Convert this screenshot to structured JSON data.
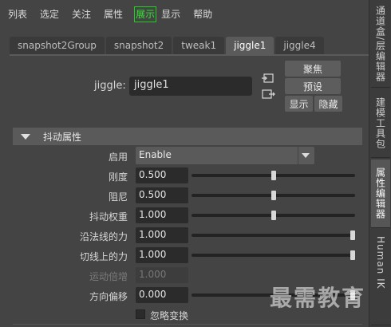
{
  "menu": [
    "列表",
    "选定",
    "关注",
    "属性",
    "展示",
    "显示",
    "帮助"
  ],
  "right_tabs": [
    "通道盒/层编辑器",
    "建模工具包",
    "属性编辑器",
    "Human IK"
  ],
  "node_tabs": [
    "snapshot2Group",
    "snapshot2",
    "tweak1",
    "jiggle1",
    "jiggle4"
  ],
  "active_node_tab": "jiggle1",
  "node": {
    "label": "jiggle:",
    "value": "jiggle1"
  },
  "buttons": {
    "focus": "聚焦",
    "presets": "预设",
    "show": "显示",
    "hide": "隐藏"
  },
  "section": {
    "title": "抖动属性"
  },
  "enable": {
    "label": "启用",
    "value": "Enable"
  },
  "attributes": [
    {
      "label": "刚度",
      "value": "0.500",
      "fraction": 0.5
    },
    {
      "label": "阻尼",
      "value": "0.500",
      "fraction": 0.5
    },
    {
      "label": "抖动权重",
      "value": "1.000",
      "fraction": 0.5
    },
    {
      "label": "沿法线的力",
      "value": "1.000",
      "fraction": 1.0
    },
    {
      "label": "切线上的力",
      "value": "1.000",
      "fraction": 1.0
    },
    {
      "label": "运动倍增",
      "value": "1.000",
      "disabled": true
    },
    {
      "label": "方向偏移",
      "value": "0.000",
      "fraction": 1.0
    }
  ],
  "checkbox": {
    "label": "忽略变换"
  },
  "watermark": "最需教育",
  "colors": {
    "background": "#444444",
    "highlight": "#1fd11f",
    "field": "#2b2b2b"
  }
}
